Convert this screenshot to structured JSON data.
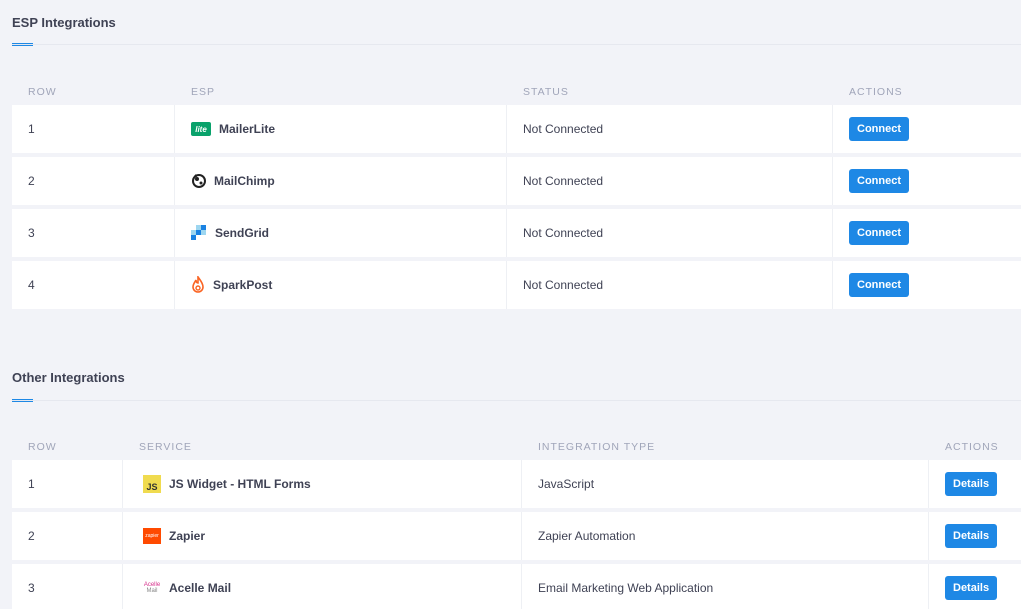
{
  "esp": {
    "title": "ESP Integrations",
    "columns": {
      "row": "ROW",
      "esp": "ESP",
      "status": "STATUS",
      "actions": "ACTIONS"
    },
    "rows": [
      {
        "row": "1",
        "name": "MailerLite",
        "icon": "mailerlite-icon",
        "icon_text": "lite",
        "status": "Not Connected",
        "action": "Connect"
      },
      {
        "row": "2",
        "name": "MailChimp",
        "icon": "mailchimp-icon",
        "status": "Not Connected",
        "action": "Connect"
      },
      {
        "row": "3",
        "name": "SendGrid",
        "icon": "sendgrid-icon",
        "status": "Not Connected",
        "action": "Connect"
      },
      {
        "row": "4",
        "name": "SparkPost",
        "icon": "sparkpost-icon",
        "status": "Not Connected",
        "action": "Connect"
      }
    ]
  },
  "other": {
    "title": "Other Integrations",
    "columns": {
      "row": "ROW",
      "service": "SERVICE",
      "type": "INTEGRATION TYPE",
      "actions": "ACTIONS"
    },
    "rows": [
      {
        "row": "1",
        "name": "JS Widget - HTML Forms",
        "icon": "javascript-icon",
        "icon_text": "JS",
        "type": "JavaScript",
        "action": "Details"
      },
      {
        "row": "2",
        "name": "Zapier",
        "icon": "zapier-icon",
        "icon_text": "zapier",
        "type": "Zapier Automation",
        "action": "Details"
      },
      {
        "row": "3",
        "name": "Acelle Mail",
        "icon": "acelle-mail-icon",
        "icon_text_1": "Acelle",
        "icon_text_2": "Mail",
        "type": "Email Marketing Web Application",
        "action": "Details"
      }
    ]
  },
  "colors": {
    "accent": "#1e88e5",
    "page_bg": "#f2f3f8",
    "header_text": "#a0a5b9",
    "mailerlite": "#09a26b",
    "sendgrid": "#1a82e2",
    "sparkpost": "#fa6423",
    "zapier": "#ff4a00",
    "javascript": "#f0db4f"
  }
}
